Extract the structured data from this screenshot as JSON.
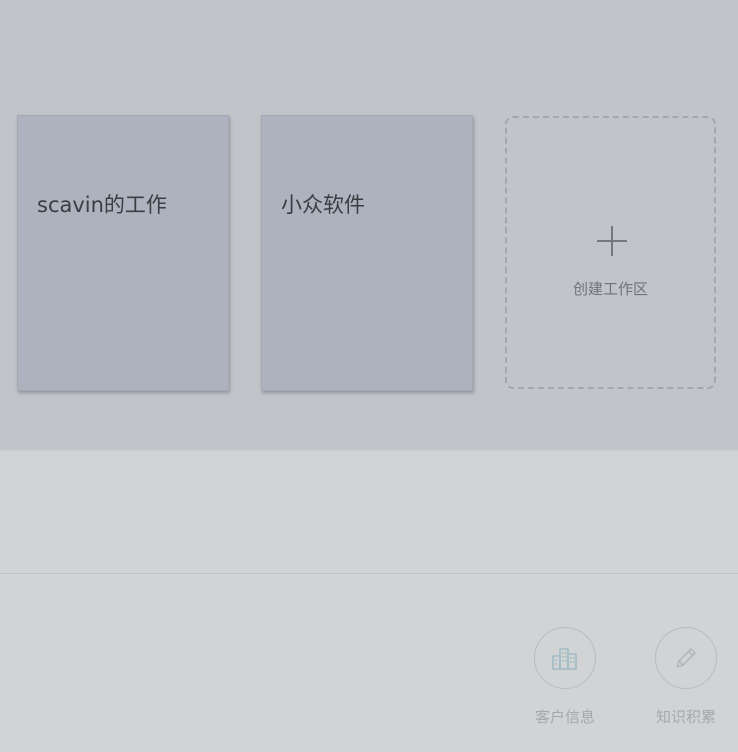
{
  "workspaces": [
    {
      "name": "scavin的工作"
    },
    {
      "name": "小众软件"
    }
  ],
  "create_workspace": {
    "label": "创建工作区"
  },
  "toolbar": {
    "items": [
      {
        "label": "客户信息",
        "icon": "buildings-icon"
      },
      {
        "label": "知识积累",
        "icon": "pencil-icon"
      }
    ]
  },
  "colors": {
    "top_area_bg": "#c1c4c8",
    "page_bg": "#d2d3d4",
    "card_bg": "#adb2be",
    "card_text": "#3a3d42",
    "icon_accent": "#9fbcc4"
  }
}
